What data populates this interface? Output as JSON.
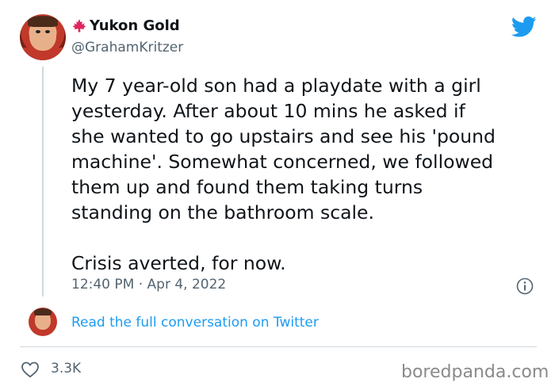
{
  "author": {
    "display_name": "Yukon Gold",
    "handle": "@GrahamKritzer",
    "flag_icon": "maple-leaf-icon",
    "flag_color": "#e0245e"
  },
  "tweet": {
    "text": "My 7 year-old son had a playdate with a girl\nyesterday. After about 10 mins he asked if\nshe wanted to go upstairs and see his 'pound\nmachine'. Somewhat concerned, we followed\nthem up and found them taking turns\nstanding on the bathroom scale.\n\nCrisis averted, for now.",
    "timestamp": "12:40 PM · Apr 4, 2022"
  },
  "conversation_link": "Read the full conversation on Twitter",
  "engagement": {
    "likes": "3.3K"
  },
  "watermark": "boredpanda.com",
  "colors": {
    "twitter_blue": "#1d9bf0",
    "secondary_text": "#536471",
    "divider": "#cfd9de"
  }
}
